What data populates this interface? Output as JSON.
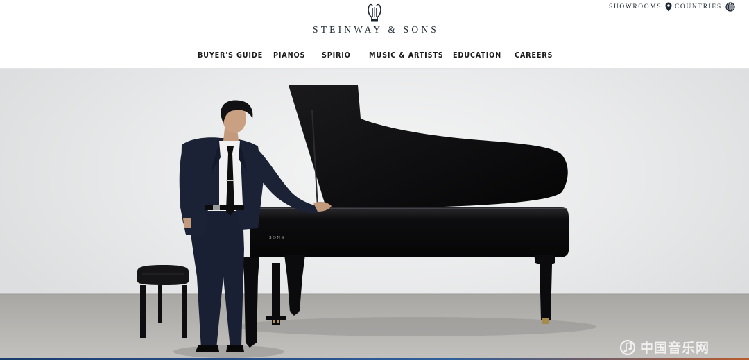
{
  "header": {
    "brand_name": "STEINWAY & SONS",
    "logo_icon": "lyre-logo-icon",
    "utility_links": [
      {
        "label": "SHOWROOMS",
        "icon": "map-pin-icon"
      },
      {
        "label": "COUNTRIES",
        "icon": "globe-icon"
      }
    ]
  },
  "nav": {
    "items": [
      {
        "label": "BUYER'S GUIDE"
      },
      {
        "label": "PIANOS"
      },
      {
        "label": "SPIRIO"
      },
      {
        "label": "MUSIC & ARTISTS"
      },
      {
        "label": "EDUCATION"
      },
      {
        "label": "CAREERS"
      }
    ]
  },
  "hero": {
    "piano_fallboard_text": "SONS",
    "watermark_text": "中国音乐网",
    "colors": {
      "piano": "#0c0c0e",
      "suit": "#1b2236",
      "floor": "#b6b4b1",
      "wall": "#eaebec"
    }
  }
}
